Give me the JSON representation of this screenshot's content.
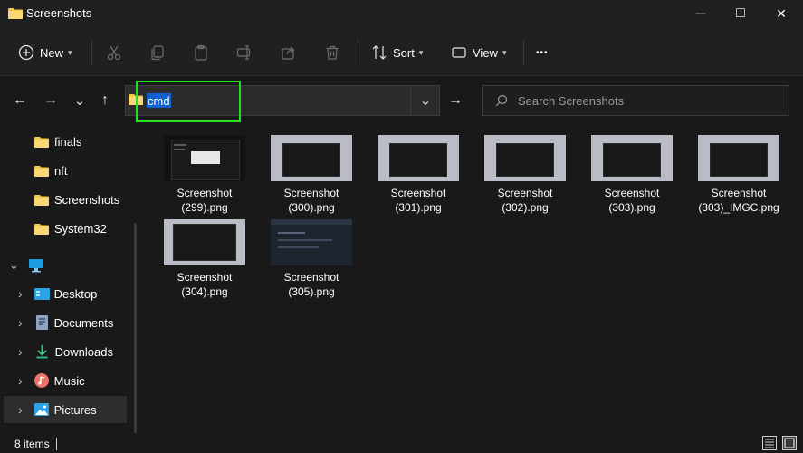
{
  "window": {
    "title": "Screenshots",
    "minimize_glyph": "—",
    "maximize_glyph": "□",
    "close_glyph": "✕"
  },
  "toolbar": {
    "new_label": "New",
    "sort_label": "Sort",
    "view_label": "View",
    "more_glyph": "•••",
    "icons": [
      "cut-icon",
      "copy-icon",
      "paste-icon",
      "rename-icon",
      "share-icon",
      "delete-icon"
    ]
  },
  "nav": {
    "back_glyph": "←",
    "forward_glyph": "→",
    "recent_glyph": "⌄",
    "up_glyph": "↑"
  },
  "address": {
    "value": "cmd",
    "dropdown_glyph": "⌄",
    "go_glyph": "→"
  },
  "search": {
    "placeholder": "Search Screenshots"
  },
  "sidebar": {
    "items": [
      {
        "label": "finals"
      },
      {
        "label": "nft"
      },
      {
        "label": "Screenshots"
      },
      {
        "label": "System32"
      },
      {
        "label": ""
      },
      {
        "label": "Desktop"
      },
      {
        "label": "Documents"
      },
      {
        "label": "Downloads"
      },
      {
        "label": "Music"
      },
      {
        "label": "Pictures"
      }
    ],
    "expander_glyph": "›",
    "expanded_glyph": "⌄"
  },
  "files": [
    {
      "line1": "Screenshot",
      "line2": "(299).png"
    },
    {
      "line1": "Screenshot",
      "line2": "(300).png"
    },
    {
      "line1": "Screenshot",
      "line2": "(301).png"
    },
    {
      "line1": "Screenshot",
      "line2": "(302).png"
    },
    {
      "line1": "Screenshot",
      "line2": "(303).png"
    },
    {
      "line1": "Screenshot",
      "line2": "(303)_IMGC.png"
    },
    {
      "line1": "Screenshot",
      "line2": "(304).png"
    },
    {
      "line1": "Screenshot",
      "line2": "(305).png"
    }
  ],
  "status": {
    "item_count": "8 items"
  },
  "colors": {
    "accent": "#0f62cf",
    "highlight_box": "#27e01f",
    "folder": "#f2c94c"
  }
}
